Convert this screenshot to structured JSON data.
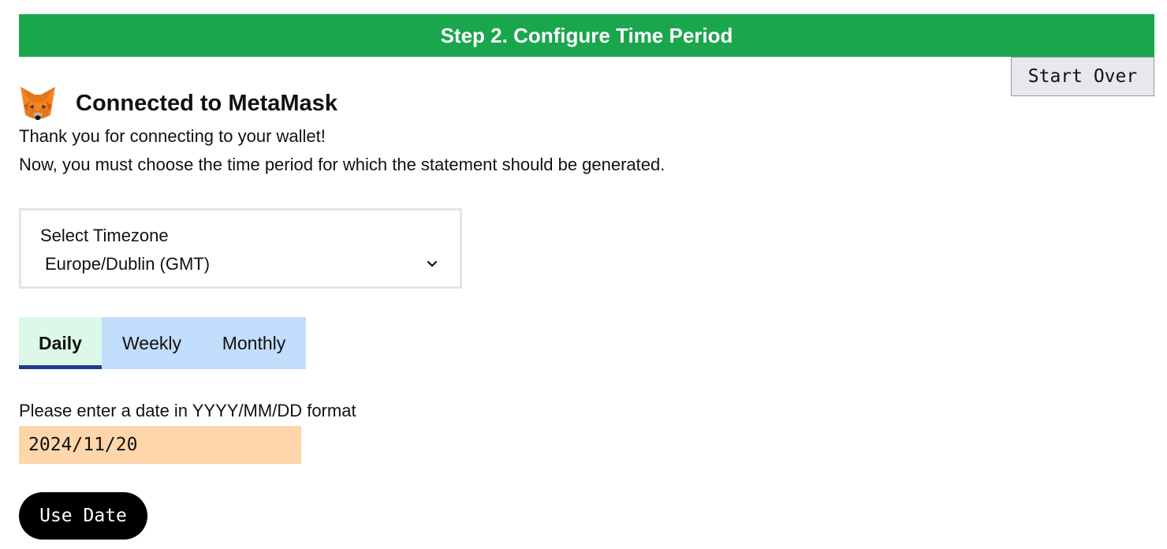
{
  "header": {
    "step_title": "Step 2. Configure Time Period",
    "start_over_label": "Start Over",
    "banner_color": "#1aa64d"
  },
  "connection": {
    "icon": "metamask-fox-icon",
    "title": "Connected to MetaMask",
    "line1": "Thank you for connecting to your wallet!",
    "line2": "Now, you must choose the time period for which the statement should be generated."
  },
  "timezone": {
    "label": "Select Timezone",
    "selected": "Europe/Dublin (GMT)"
  },
  "period_tabs": {
    "active": "Daily",
    "items": [
      {
        "label": "Daily"
      },
      {
        "label": "Weekly"
      },
      {
        "label": "Monthly"
      }
    ]
  },
  "date_entry": {
    "label": "Please enter a date in YYYY/MM/DD format",
    "value": "2024/11/20",
    "submit_label": "Use Date"
  }
}
